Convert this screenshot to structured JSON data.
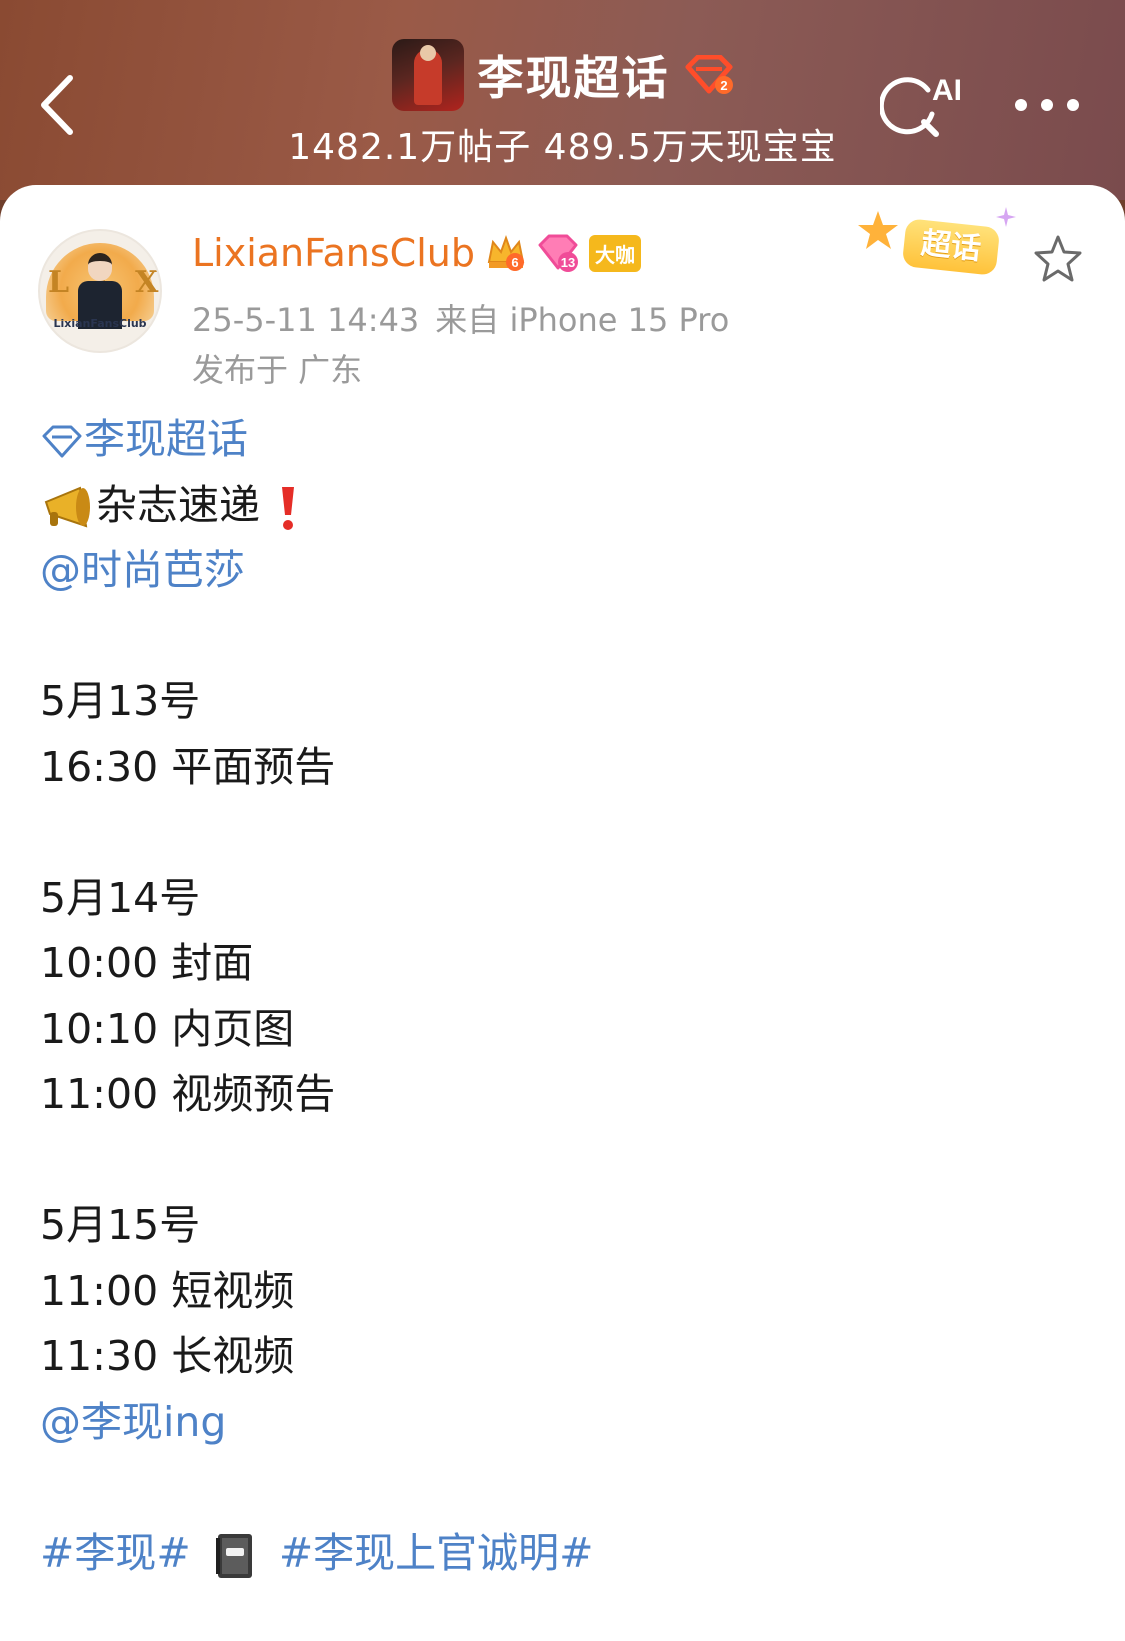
{
  "header": {
    "title": "李现超话",
    "stats": "1482.1万帖子 489.5万天现宝宝",
    "ai_label": "AI",
    "topic_level": "2"
  },
  "post": {
    "author": "LixianFansClub",
    "badge_crown_level": "6",
    "badge_gem_level": "13",
    "badge_role": "大咖",
    "timestamp": "25-5-11 14:43",
    "source": "来自 iPhone 15 Pro",
    "location": "发布于 广东",
    "avatar_text": "LIXIAN",
    "avatar_club": "LixianFansClub",
    "sticker_label": "超话",
    "body": {
      "topic_link": "李现超话",
      "announce": "杂志速递",
      "mention_1": "@时尚芭莎",
      "day1_date": "5月13号",
      "day1_item1": "16:30 平面预告",
      "day2_date": "5月14号",
      "day2_item1": "10:00 封面",
      "day2_item2": "10:10 内页图",
      "day2_item3": "11:00 视频预告",
      "day3_date": "5月15号",
      "day3_item1": "11:00 短视频",
      "day3_item2": "11:30 长视频",
      "mention_2": "@李现ing",
      "hashtag_1": "#李现#",
      "hashtag_2": "#李现上官诚明#"
    }
  },
  "colors": {
    "username": "#eb7421",
    "link": "#4e82c7",
    "meta": "#9a9a9a"
  }
}
